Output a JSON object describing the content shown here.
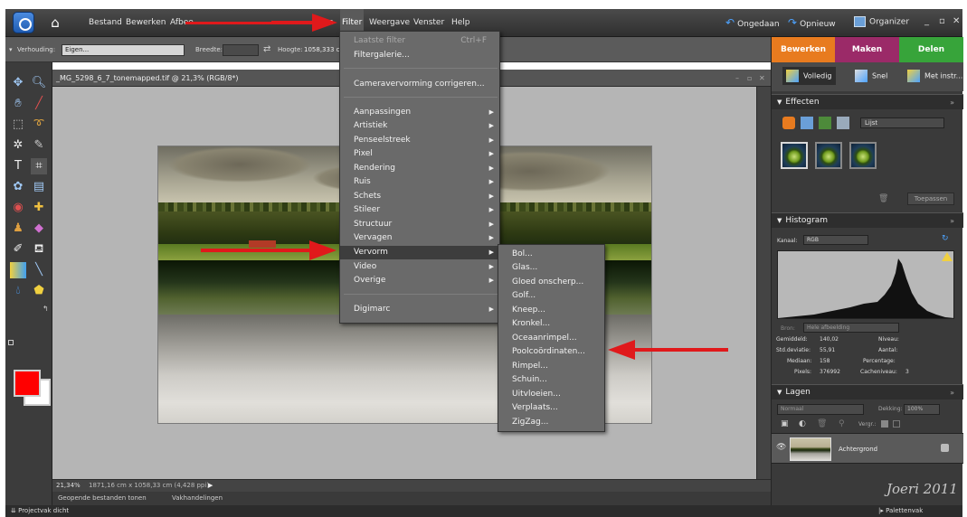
{
  "menubar": {
    "items": [
      "Bestand",
      "Bewerken",
      "Afbee",
      "",
      "ren",
      "Filter",
      "Weergave",
      "Venster",
      "Help"
    ],
    "undo_label": "Ongedaan",
    "redo_label": "Opnieuw",
    "organizer_label": "Organizer"
  },
  "options": {
    "ratio_label": "Verhouding:",
    "ratio_value": "Eigen...",
    "width_label": "Breedte:",
    "height_label": "Hoogte:",
    "height_value": "1058,333 cm"
  },
  "document": {
    "tab_title": "_MG_5298_6_7_tonemapped.tif @ 21,3% (RGB/8*)",
    "status_zoom": "21,34%",
    "status_size": "1871,16 cm x 1058,33 cm (4,428 ppi)",
    "project_bin_label": "Projectvak dicht",
    "palette_bin_label": "Palettenvak",
    "bin_tab_1": "Geopende bestanden tonen",
    "bin_tab_2": "Vakhandelingen"
  },
  "filter_menu": {
    "items": [
      {
        "label": "Laatste filter",
        "shortcut": "Ctrl+F",
        "disabled": true
      },
      {
        "label": "Filtergalerie..."
      },
      {
        "label": "Cameravervorming corrigeren..."
      },
      {
        "label": "Aanpassingen",
        "submenu": true
      },
      {
        "label": "Artistiek",
        "submenu": true
      },
      {
        "label": "Penseelstreek",
        "submenu": true
      },
      {
        "label": "Pixel",
        "submenu": true
      },
      {
        "label": "Rendering",
        "submenu": true
      },
      {
        "label": "Ruis",
        "submenu": true
      },
      {
        "label": "Schets",
        "submenu": true
      },
      {
        "label": "Stileer",
        "submenu": true
      },
      {
        "label": "Structuur",
        "submenu": true
      },
      {
        "label": "Vervagen",
        "submenu": true
      },
      {
        "label": "Vervorm",
        "submenu": true,
        "highlighted": true
      },
      {
        "label": "Video",
        "submenu": true
      },
      {
        "label": "Overige",
        "submenu": true
      },
      {
        "label": "Digimarc",
        "submenu": true
      }
    ]
  },
  "distort_submenu": {
    "items": [
      "Bol...",
      "Glas...",
      "Gloed onscherp...",
      "Golf...",
      "Kneep...",
      "Kronkel...",
      "Oceaanrimpel...",
      "Poolcoördinaten...",
      "Rimpel...",
      "Schuin...",
      "Uitvloeien...",
      "Verplaats...",
      "ZigZag..."
    ]
  },
  "right_panel": {
    "tabs": [
      "Bewerken",
      "Maken",
      "Delen"
    ],
    "modes": [
      "Volledig",
      "Snel",
      "Met instr..."
    ],
    "effects_title": "Effecten",
    "effects_filter_value": "Lijst",
    "apply_label": "Toepassen",
    "histogram_title": "Histogram",
    "channel_label": "Kanaal:",
    "channel_value": "RGB",
    "source_label": "Bron:",
    "source_value": "Hele afbeelding",
    "stats": {
      "mean_label": "Gemiddeld:",
      "mean": "140,02",
      "std_label": "Std.deviatie:",
      "std": "55,91",
      "median_label": "Mediaan:",
      "median": "158",
      "pixels_label": "Pixels:",
      "pixels": "376992",
      "level_label": "Niveau:",
      "count_label": "Aantal:",
      "percent_label": "Percentage:",
      "cache_label": "Cacheniveau:",
      "cache": "3"
    },
    "layers_title": "Lagen",
    "blend_value": "Normaal",
    "opacity_label": "Dekking:",
    "opacity_value": "100%",
    "lock_label": "Vergr.:",
    "layer_name": "Achtergrond"
  },
  "watermark": "Joeri 2011",
  "colors": {
    "accent_red": "#e0191b",
    "tab_bewerken": "#e87b1f",
    "tab_maken": "#9b2a68",
    "tab_delen": "#37a43a"
  }
}
